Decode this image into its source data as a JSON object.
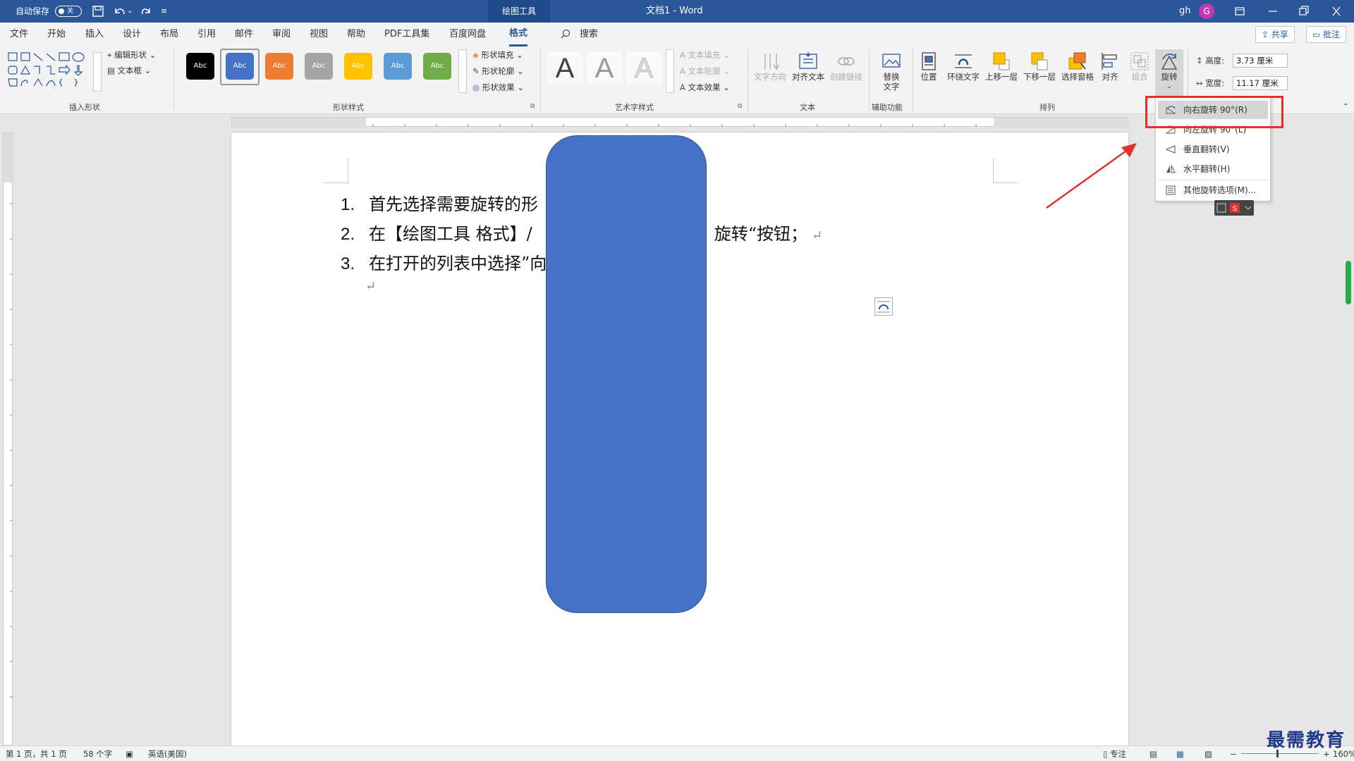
{
  "titlebar": {
    "autosave_label": "自动保存",
    "autosave_state": "关",
    "undo_dropdown": "⌄",
    "qat_more": "≡",
    "context_tab": "绘图工具",
    "doc_title": "文档1 - Word",
    "user_initials": "gh",
    "avatar_letter": "G"
  },
  "tabs": {
    "items": [
      "文件",
      "开始",
      "插入",
      "设计",
      "布局",
      "引用",
      "邮件",
      "审阅",
      "视图",
      "帮助",
      "PDF工具集",
      "百度网盘",
      "格式"
    ],
    "active": "格式",
    "search": "搜索",
    "share": "共享",
    "comments": "批注"
  },
  "ribbon": {
    "insert_shapes": {
      "label": "插入形状",
      "edit_shape": "编辑形状",
      "text_box": "文本框"
    },
    "shape_styles": {
      "label": "形状样式",
      "swatch_text": "Abc",
      "swatches": [
        "#000000",
        "#4472c4",
        "#ed7d31",
        "#a5a5a5",
        "#ffc000",
        "#5b9bd5",
        "#70ad47"
      ],
      "fill": "形状填充",
      "outline": "形状轮廓",
      "effects": "形状效果"
    },
    "wordart_styles": {
      "label": "艺术字样式",
      "glyph": "A",
      "text_fill": "文本填充",
      "text_outline": "文本轮廓",
      "text_effects": "文本效果"
    },
    "text": {
      "label": "文本",
      "direction": "文字方向",
      "align": "对齐文本",
      "link": "创建链接"
    },
    "accessibility": {
      "label": "辅助功能",
      "alt_text": "替换\n文字",
      "alt_text_line1": "替换",
      "alt_text_line2": "文字"
    },
    "arrange": {
      "label": "排列",
      "position": "位置",
      "wrap": "环绕文字",
      "forward": "上移一层",
      "backward": "下移一层",
      "pane": "选择窗格",
      "align": "对齐",
      "group": "组合",
      "rotate": "旋转"
    },
    "size": {
      "height_label": "高度:",
      "height_value": "3.73 厘米",
      "width_label": "宽度:",
      "width_value": "11.17 厘米"
    }
  },
  "document": {
    "lines": [
      {
        "num": "1.",
        "text": "首先选择需要旋转的形",
        "ret": ""
      },
      {
        "num": "2.",
        "text": "在【绘图工具  格式】/",
        "tail": "旋转“按钮；",
        "ret": "↵"
      },
      {
        "num": "3.",
        "text": "在打开的列表中选择”向",
        "ret": ""
      }
    ],
    "empty_para": "↵",
    "shape_color": "#4472c4"
  },
  "rotate_menu": {
    "items": [
      {
        "label": "向右旋转 90°(R)",
        "icon": "rotate-right-icon"
      },
      {
        "label": "向左旋转 90°(L)",
        "icon": "rotate-left-icon"
      },
      {
        "label": "垂直翻转(V)",
        "icon": "flip-vertical-icon"
      },
      {
        "label": "水平翻转(H)",
        "icon": "flip-horizontal-icon"
      },
      {
        "label": "其他旋转选项(M)...",
        "icon": "more-rotate-options-icon"
      }
    ],
    "highlight_color": "#e0312e"
  },
  "statusbar": {
    "page": "第 1 页，共 1 页",
    "words": "58 个字",
    "language": "英语(美国)",
    "focus": "专注",
    "zoom": "160%"
  },
  "watermark": "最需教育"
}
